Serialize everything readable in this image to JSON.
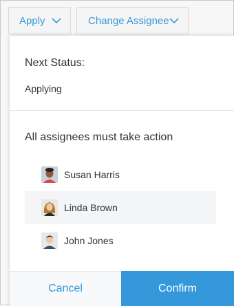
{
  "toolbar": {
    "apply_label": "Apply",
    "change_assignee_label": "Change Assignee"
  },
  "dialog": {
    "next_status_label": "Next Status:",
    "next_status_value": "Applying",
    "assignees_heading": "All assignees must take action",
    "assignees": [
      {
        "name": "Susan Harris",
        "avatar_icon": "person-photo-icon",
        "highlighted": false
      },
      {
        "name": "Linda Brown",
        "avatar_icon": "person-photo-icon",
        "highlighted": true
      },
      {
        "name": "John Jones",
        "avatar_icon": "person-photo-icon",
        "highlighted": false
      }
    ],
    "cancel_label": "Cancel",
    "confirm_label": "Confirm"
  },
  "colors": {
    "accent": "#3498db",
    "confirm_text": "#ffffff",
    "highlight_row": "#f4f5f7"
  }
}
